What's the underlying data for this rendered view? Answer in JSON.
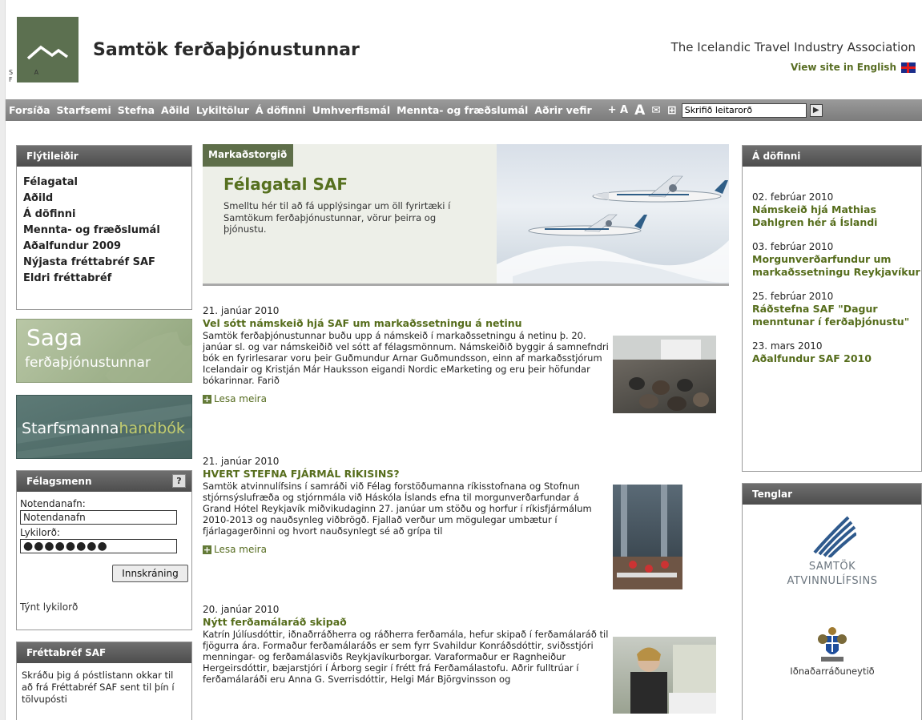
{
  "header": {
    "logo_letters": "S A F",
    "site_name": "Samtök ferðaþjónustunnar",
    "site_name_en": "The Icelandic Travel Industry Association",
    "view_english": "View site in English"
  },
  "nav": {
    "items": [
      "Forsíða",
      "Starfsemi",
      "Stefna",
      "Aðild",
      "Lykiltölur",
      "Á döfinni",
      "Umhverfismál",
      "Mennta- og fræðslumál",
      "Aðrir vefir"
    ],
    "font_small": "+ A",
    "font_large": "A",
    "search_placeholder": "Skrifið leitarorð"
  },
  "quick_links": {
    "heading": "Flýtileiðir",
    "items": [
      "Félagatal",
      "Aðild",
      "Á döfinni",
      "Mennta- og fræðslumál",
      "Aðalfundur 2009",
      "Nýjasta fréttabréf SAF",
      "Eldri fréttabréf"
    ]
  },
  "banners": {
    "saga_line1": "Saga",
    "saga_line2": "ferðaþjónustunnar",
    "starfs_part1": "Starfsmanna",
    "starfs_part2": "handbók"
  },
  "login": {
    "heading": "Félagsmenn",
    "help": "?",
    "username_label": "Notendanafn:",
    "username_value": "Notendanafn",
    "password_label": "Lykilorð:",
    "password_value": "●●●●●●●●",
    "submit": "Innskráning",
    "lost_password": "Týnt lykilorð"
  },
  "newsletter": {
    "heading": "Fréttabréf SAF",
    "text": "Skráðu þig á póstlistann okkar til að frá Fréttabréf SAF sent til þín í tölvupósti"
  },
  "feature": {
    "tab": "Markaðstorgið",
    "title": "Félagatal SAF",
    "text": "Smelltu hér til að fá upplýsingar um öll fyrirtæki í Samtökum ferðaþjónustunnar, vörur þeirra og þjónustu."
  },
  "news": [
    {
      "date": "21. janúar 2010",
      "title": "Vel sótt námskeið hjá SAF um markaðssetningu á netinu",
      "body": "Samtök ferðaþjónustunnar buðu upp á námskeið í markaðssetningu á netinu þ. 20. janúar sl. og var námskeiðið vel sótt af félagsmönnum. Námskeiðið byggir á samnefndri bók en fyrirlesarar voru þeir Guðmundur Arnar Guðmundsson, einn af markaðsstjórum Icelandair og Kristján Már Hauksson eigandi Nordic eMarketing og eru þeir höfundar bókarinnar. Farið",
      "more": "Lesa meira"
    },
    {
      "date": "21. janúar 2010",
      "title": "HVERT STEFNA FJÁRMÁL RÍKISINS?",
      "body": "Samtök atvinnulífsins í samráði við Félag forstöðumanna ríkisstofnana og Stofnun stjórnsýslufræða og stjórnmála við Háskóla Íslands efna til morgunverðarfundar á Grand Hótel Reykjavík miðvikudaginn 27. janúar um stöðu og horfur í ríkisfjármálum 2010-2013 og nauðsynleg viðbrögð. Fjallað verður um mögulegar umbætur í fjárlagagerðinni og hvort nauðsynlegt sé að grípa til",
      "more": "Lesa meira"
    },
    {
      "date": "20. janúar 2010",
      "title": "Nýtt ferðamálaráð skipað",
      "body": "Katrín Júlíusdóttir, iðnaðrráðherra og ráðherra ferðamála, hefur skipað í ferðamálaráð til fjögurra ára. Formaður ferðamálaráðs er sem fyrr Svahildur Konráðsdóttir, sviðsstjóri menningar- og ferðamálasviðs Reykjavíkurborgar. Varaformaður er Ragnheiður Hergeirsdóttir, bæjarstjóri í Árborg segir í frétt frá Ferðamálastofu. Aðrir fulltrúar í ferðamálaráði eru Anna G. Sverrisdóttir, Helgi Már Björgvinsson og",
      "more": ""
    }
  ],
  "events": {
    "heading": "Á döfinni",
    "items": [
      {
        "date": "02. febrúar 2010",
        "title": "Námskeið hjá Mathias Dahlgren hér á Íslandi"
      },
      {
        "date": "03. febrúar 2010",
        "title": "Morgunverðarfundur um markaðssetningu Reykjavíkur"
      },
      {
        "date": "25. febrúar 2010",
        "title": "Ráðstefna SAF \"Dagur menntunar í ferðaþjónustu\""
      },
      {
        "date": "23. mars 2010",
        "title": "Aðalfundur SAF 2010"
      }
    ]
  },
  "links": {
    "heading": "Tenglar",
    "sa_line1": "SAMTÖK",
    "sa_line2": "ATVINNULÍFSINS",
    "ministry": "Iðnaðarráðuneytið"
  },
  "colors": {
    "accent_green": "#566d1c",
    "nav_gray": "#8a8a8a",
    "box_header": "#5e5e5e"
  }
}
